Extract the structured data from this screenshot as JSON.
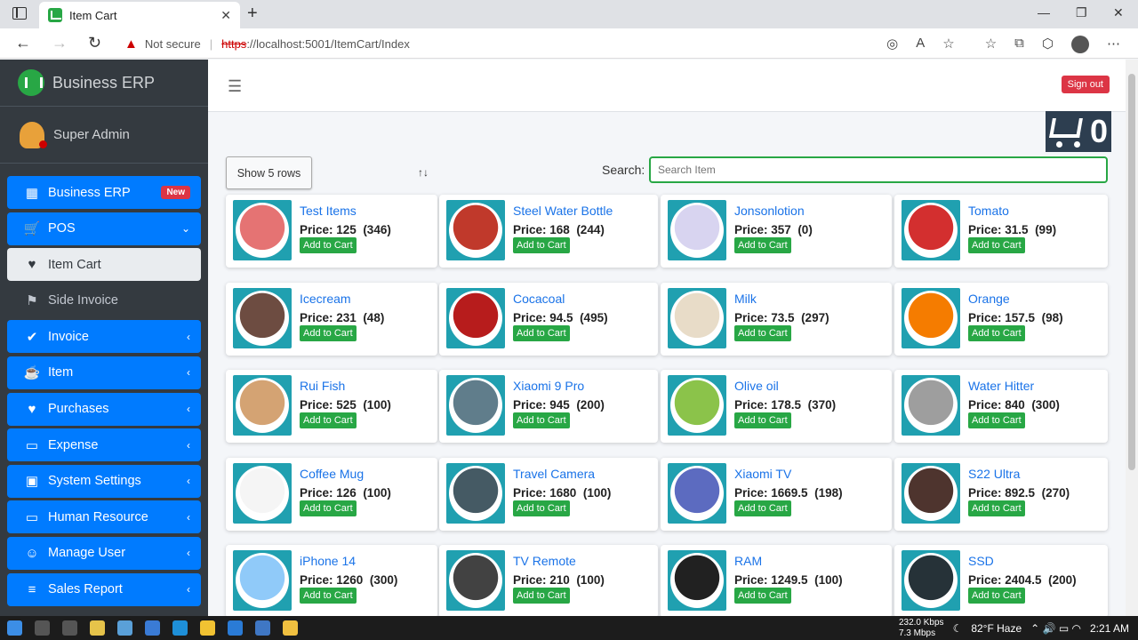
{
  "browser": {
    "tab_title": "Item Cart",
    "not_secure": "Not secure",
    "url_scheme": "https",
    "url_rest": "://localhost:5001/ItemCart/Index"
  },
  "sidebar": {
    "brand": "Business ERP",
    "user": "Super Admin",
    "items": [
      {
        "label": "Business ERP",
        "icon": "grid-icon",
        "badge": "New",
        "style": "blue"
      },
      {
        "label": "POS",
        "icon": "cart-icon",
        "style": "blue",
        "arrow": "down"
      },
      {
        "label": "Item Cart",
        "icon": "heart-icon",
        "style": "active"
      },
      {
        "label": "Side Invoice",
        "icon": "flag-icon",
        "style": "plain"
      },
      {
        "label": "Invoice",
        "icon": "check-circle-icon",
        "style": "blue",
        "arrow": "left"
      },
      {
        "label": "Item",
        "icon": "coffee-icon",
        "style": "blue",
        "arrow": "left"
      },
      {
        "label": "Purchases",
        "icon": "heart-icon",
        "style": "blue",
        "arrow": "left"
      },
      {
        "label": "Expense",
        "icon": "monitor-icon",
        "style": "blue",
        "arrow": "left"
      },
      {
        "label": "System Settings",
        "icon": "robot-icon",
        "style": "blue",
        "arrow": "left"
      },
      {
        "label": "Human Resource",
        "icon": "monitor-icon",
        "style": "blue",
        "arrow": "left"
      },
      {
        "label": "Manage User",
        "icon": "user-gear-icon",
        "style": "blue",
        "arrow": "left"
      },
      {
        "label": "Sales Report",
        "icon": "database-icon",
        "style": "blue",
        "arrow": "left"
      }
    ]
  },
  "header": {
    "sign_out": "Sign out",
    "cart_count": "0"
  },
  "controls": {
    "show_rows": "Show 5 rows",
    "search_label": "Search:",
    "search_placeholder": "Search Item"
  },
  "products": [
    {
      "name": "Test Items",
      "price": "Price: 125",
      "qty": "(346)",
      "color": "#e57373"
    },
    {
      "name": "Steel Water Bottle",
      "price": "Price: 168",
      "qty": "(244)",
      "color": "#c0392b"
    },
    {
      "name": "Jonsonlotion",
      "price": "Price: 357",
      "qty": "(0)",
      "color": "#d8d4f0"
    },
    {
      "name": "Tomato",
      "price": "Price: 31.5",
      "qty": "(99)",
      "color": "#d32f2f"
    },
    {
      "name": "Icecream",
      "price": "Price: 231",
      "qty": "(48)",
      "color": "#6d4c41"
    },
    {
      "name": "Cocacoal",
      "price": "Price: 94.5",
      "qty": "(495)",
      "color": "#b71c1c"
    },
    {
      "name": "Milk",
      "price": "Price: 73.5",
      "qty": "(297)",
      "color": "#e8dcc8"
    },
    {
      "name": "Orange",
      "price": "Price: 157.5",
      "qty": "(98)",
      "color": "#f57c00"
    },
    {
      "name": "Rui Fish",
      "price": "Price: 525",
      "qty": "(100)",
      "color": "#d4a373"
    },
    {
      "name": "Xiaomi 9 Pro",
      "price": "Price: 945",
      "qty": "(200)",
      "color": "#607d8b"
    },
    {
      "name": "Olive oil",
      "price": "Price: 178.5",
      "qty": "(370)",
      "color": "#8bc34a"
    },
    {
      "name": "Water Hitter",
      "price": "Price: 840",
      "qty": "(300)",
      "color": "#9e9e9e"
    },
    {
      "name": "Coffee Mug",
      "price": "Price: 126",
      "qty": "(100)",
      "color": "#f5f5f5"
    },
    {
      "name": "Travel Camera",
      "price": "Price: 1680",
      "qty": "(100)",
      "color": "#455a64"
    },
    {
      "name": "Xiaomi TV",
      "price": "Price: 1669.5",
      "qty": "(198)",
      "color": "#5c6bc0"
    },
    {
      "name": "S22 Ultra",
      "price": "Price: 892.5",
      "qty": "(270)",
      "color": "#4e342e"
    },
    {
      "name": "iPhone 14",
      "price": "Price: 1260",
      "qty": "(300)",
      "color": "#90caf9"
    },
    {
      "name": "TV Remote",
      "price": "Price: 210",
      "qty": "(100)",
      "color": "#424242"
    },
    {
      "name": "RAM",
      "price": "Price: 1249.5",
      "qty": "(100)",
      "color": "#212121"
    },
    {
      "name": "SSD",
      "price": "Price: 2404.5",
      "qty": "(200)",
      "color": "#263238"
    }
  ],
  "add_label": "Add to Cart",
  "taskbar": {
    "net_up": "232.0 Kbps",
    "net_down": "7.3 Mbps",
    "weather": "82°F  Haze",
    "time": "2:21 AM"
  }
}
